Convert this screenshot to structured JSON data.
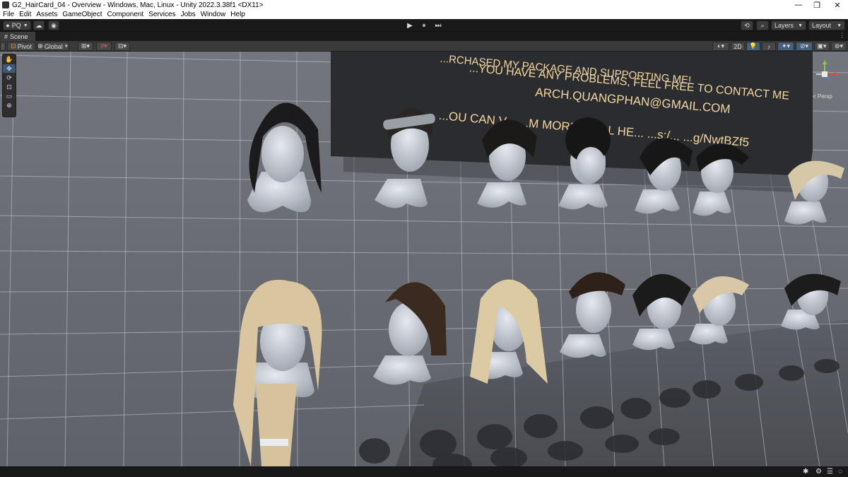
{
  "window": {
    "title": "G2_HairCard_04 - Overview - Windows, Mac, Linux - Unity 2022.3.38f1 <DX11>",
    "minimize": "—",
    "maximize": "❐",
    "close": "✕"
  },
  "menu": [
    "File",
    "Edit",
    "Assets",
    "GameObject",
    "Component",
    "Services",
    "Jobs",
    "Window",
    "Help"
  ],
  "toolbar": {
    "account": "PQ",
    "layers": "Layers",
    "layout": "Layout",
    "play_icon": "▶",
    "pause_icon": "⏸",
    "step_icon": "⏭"
  },
  "scene_tab": {
    "label": "Scene",
    "icon": "scene-hashtag-icon"
  },
  "scene_toolbar": {
    "pivot": "Pivot",
    "global": "Global",
    "mode_2d": "2D"
  },
  "gizmo": {
    "projection": "< Persp"
  },
  "sign": {
    "line1": "...RCHASED MY PACKAGE AND SUPPORTING ME!",
    "line2": "...YOU HAVE ANY PROBLEMS, FEEL FREE TO CONTACT ME",
    "line3": "ARCH.QUANGPHAN@GMAIL.COM",
    "line4": "...OU CAN V... ...M MORE ...HAL HE... ...s:/... ...g/NwtBZf5"
  },
  "colors": {
    "editor_bg": "#191919",
    "panel": "#3c3c3c",
    "accent_blue": "#46607c",
    "grid_wall": "#6b6f76",
    "sign_bg": "#2b2c30",
    "sign_text": "#f3d6a0"
  }
}
